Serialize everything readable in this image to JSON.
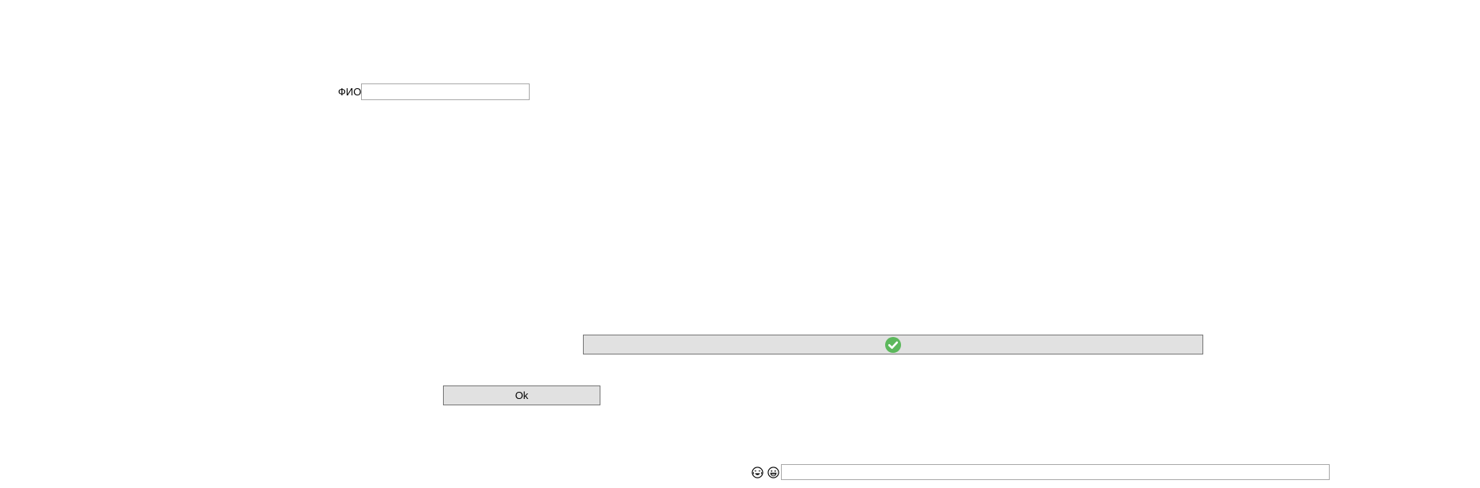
{
  "form": {
    "fio_label": "ФИО",
    "fio_value": "",
    "fio_placeholder": ""
  },
  "confirm_button": {
    "icon": "check-circle-icon",
    "icon_color": "#5cb85c"
  },
  "ok_button": {
    "label": "Ok"
  },
  "emoji_bar": {
    "icons": [
      "crying-laughing-face-icon",
      "grinning-face-icon"
    ],
    "input_value": "",
    "input_placeholder": ""
  },
  "colors": {
    "button_bg": "#e1e1e1",
    "button_border": "#777777",
    "input_border": "#a9a9a9"
  }
}
